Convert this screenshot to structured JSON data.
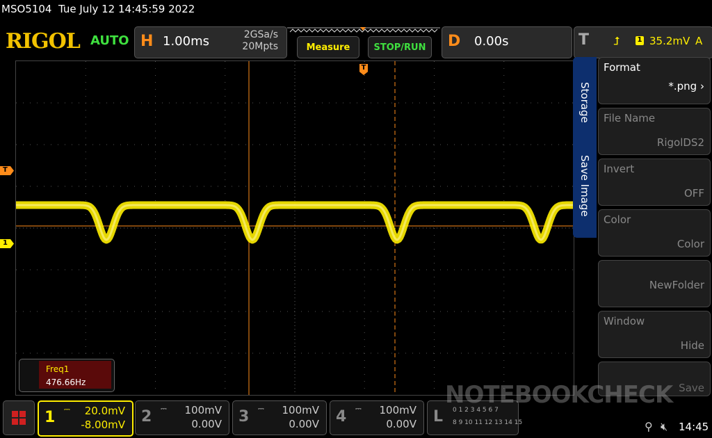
{
  "topbar": {
    "model": "MSO5104",
    "datetime": "Tue July 12 14:45:59 2022"
  },
  "header": {
    "logo": "RIGOL",
    "mode": "AUTO",
    "h_letter": "H",
    "timebase": "1.00ms",
    "sample_rate": "2GSa/s",
    "mem_depth": "20Mpts",
    "measure_label": "Measure",
    "stoprun_label": "STOP/RUN",
    "d_letter": "D",
    "delay": "0.00s",
    "t_letter": "T",
    "trigger_source": "1",
    "trigger_level": "35.2mV",
    "trigger_mode": "A"
  },
  "markers": {
    "trigger_marker": "T",
    "ch1_marker": "1"
  },
  "measure_box": {
    "label": "Freq1",
    "value": "476.66Hz"
  },
  "side_tabs": {
    "storage": "Storage",
    "save_image": "Save Image"
  },
  "menu": [
    {
      "title": "Format",
      "value": "*.png"
    },
    {
      "title": "File Name",
      "value": "RigolDS2"
    },
    {
      "title": "Invert",
      "value": "OFF"
    },
    {
      "title": "Color",
      "value": "Color"
    },
    {
      "title": "",
      "value": "NewFolder"
    },
    {
      "title": "Window",
      "value": "Hide"
    },
    {
      "title": "",
      "value": "Save"
    }
  ],
  "channels": [
    {
      "num": "1",
      "scale": "20.0mV",
      "offset": "-8.00mV",
      "color": "#ffee00",
      "active": true
    },
    {
      "num": "2",
      "scale": "100mV",
      "offset": "0.00V",
      "color": "#aaaaaa",
      "active": false
    },
    {
      "num": "3",
      "scale": "100mV",
      "offset": "0.00V",
      "color": "#aaaaaa",
      "active": false
    },
    {
      "num": "4",
      "scale": "100mV",
      "offset": "0.00V",
      "color": "#aaaaaa",
      "active": false
    }
  ],
  "logic": {
    "label": "L",
    "row1": "0 1 2 3 4 5 6 7",
    "row2": "8 9 10 11 12 13 14 15"
  },
  "status": {
    "time": "14:45"
  },
  "watermark": "NOTEBOOKCHECK",
  "colors": {
    "ch1": "#ffee00",
    "accent": "#ff8c1a",
    "ok": "#3fe03f",
    "menu_tab": "#0d2f6e"
  }
}
